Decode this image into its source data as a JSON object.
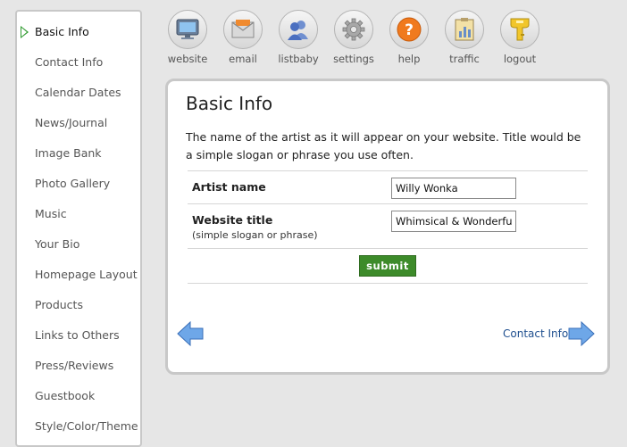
{
  "sidebar": {
    "items": [
      {
        "label": "Basic Info",
        "active": true
      },
      {
        "label": "Contact Info"
      },
      {
        "label": "Calendar Dates"
      },
      {
        "label": "News/Journal"
      },
      {
        "label": "Image Bank"
      },
      {
        "label": "Photo Gallery"
      },
      {
        "label": "Music"
      },
      {
        "label": "Your Bio"
      },
      {
        "label": "Homepage Layout"
      },
      {
        "label": "Products"
      },
      {
        "label": "Links to Others"
      },
      {
        "label": "Press/Reviews"
      },
      {
        "label": "Guestbook"
      },
      {
        "label": "Style/Color/Theme"
      }
    ]
  },
  "toolbar": {
    "items": [
      {
        "label": "website",
        "icon": "monitor-icon"
      },
      {
        "label": "email",
        "icon": "envelope-icon"
      },
      {
        "label": "listbaby",
        "icon": "people-icon"
      },
      {
        "label": "settings",
        "icon": "gear-icon"
      },
      {
        "label": "help",
        "icon": "question-icon"
      },
      {
        "label": "traffic",
        "icon": "clipboard-chart-icon"
      },
      {
        "label": "logout",
        "icon": "key-icon"
      }
    ]
  },
  "panel": {
    "title": "Basic Info",
    "description": "The name of the artist as it will appear on your website. Title would be a simple slogan or phrase you use often.",
    "fields": {
      "artist_name": {
        "label": "Artist name",
        "value": "Willy Wonka"
      },
      "website_title": {
        "label": "Website title",
        "hint": "(simple slogan or phrase)",
        "value": "Whimsical & Wonderful"
      }
    },
    "submit_label": "submit",
    "next_label": "Contact Info"
  },
  "colors": {
    "accent_green": "#3d8b2a",
    "link_blue": "#1f4f8f",
    "arrow_blue": "#5b9be0"
  }
}
